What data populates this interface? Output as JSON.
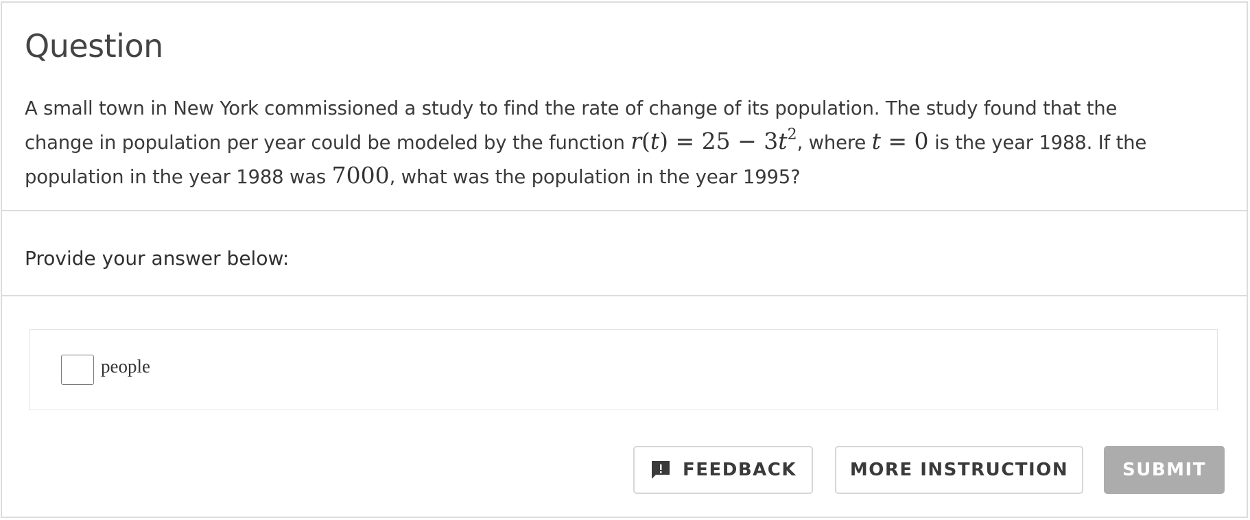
{
  "question": {
    "title": "Question",
    "line1": "A small town in New York commissioned a study to find the rate of change of its population. The study found that the",
    "line2_pre": "change in population per year could be modeled by the function ",
    "fn_r": "r",
    "fn_paren_open": "(",
    "fn_t": "t",
    "fn_rest": ") = 25 − 3",
    "fn_t2": "t",
    "fn_exp": "2",
    "line2_mid": ", where ",
    "var_t": "t",
    "eq_zero": " = 0",
    "line2_post": " is the year 1988. If the",
    "line3_pre": "population in the year 1988 was ",
    "pop_value": "7000",
    "line3_post": ", what was the population in the year 1995?"
  },
  "prompt": {
    "label": "Provide your answer below:"
  },
  "answer": {
    "value": "",
    "unit": "people"
  },
  "buttons": {
    "feedback": "FEEDBACK",
    "more_instruction": "MORE INSTRUCTION",
    "submit": "SUBMIT"
  },
  "icons": {
    "feedback": "feedback-icon"
  },
  "colors": {
    "submit_bg": "#acacac",
    "border": "#dcdcdc",
    "text": "#3a3a3a"
  }
}
